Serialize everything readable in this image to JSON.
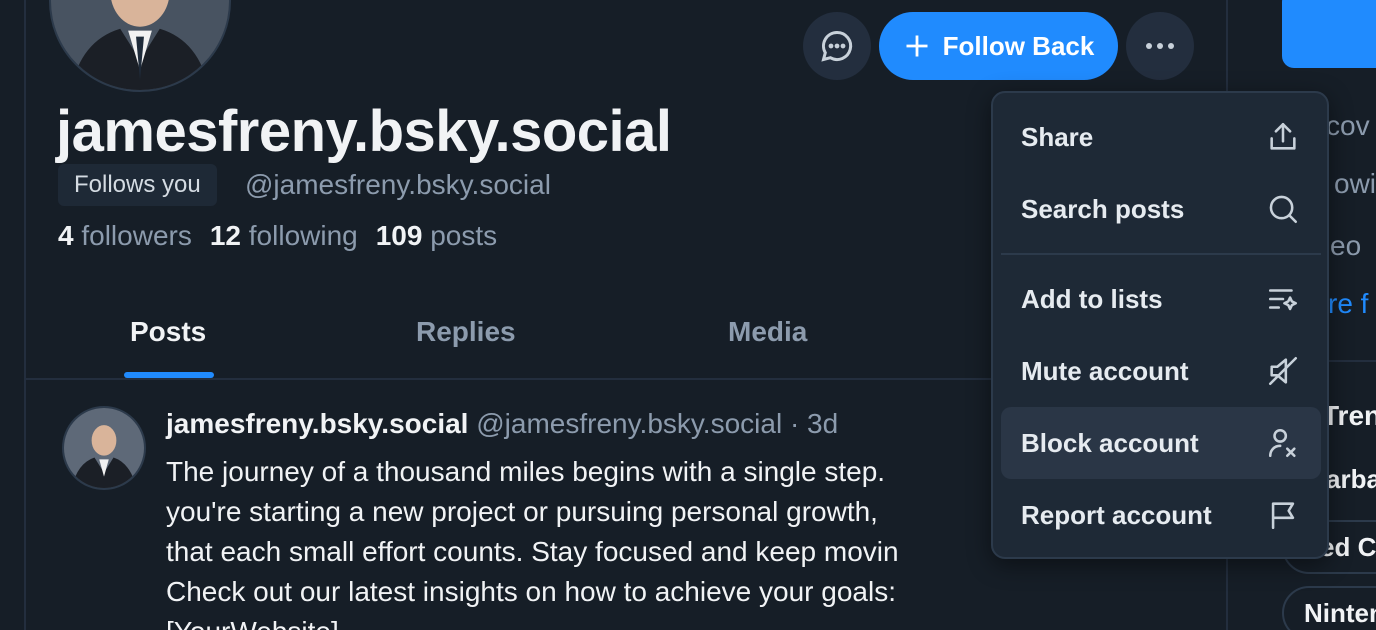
{
  "profile": {
    "display_name": "jamesfreny.bsky.social",
    "follows_you": "Follows you",
    "handle": "@jamesfreny.bsky.social",
    "stats": [
      {
        "count": "4",
        "label": "followers"
      },
      {
        "count": "12",
        "label": "following"
      },
      {
        "count": "109",
        "label": "posts"
      }
    ]
  },
  "actions": {
    "follow_back_label": "Follow Back"
  },
  "tabs": [
    "Posts",
    "Replies",
    "Media"
  ],
  "post": {
    "author": "jamesfreny.bsky.social",
    "meta": "@jamesfreny.bsky.social · 3d",
    "text_lines": [
      "The journey of a thousand miles begins with a single step.",
      "you're starting a new project or pursuing personal growth,",
      "that each small effort counts. Stay focused and keep movin",
      "Check out our latest insights on how to achieve your goals:",
      "[YourWebsite]"
    ]
  },
  "menu": {
    "items": [
      {
        "label": "Share",
        "icon": "share-icon"
      },
      {
        "label": "Search posts",
        "icon": "search-icon"
      },
      {
        "label": "Add to lists",
        "icon": "list-add-icon"
      },
      {
        "label": "Mute account",
        "icon": "mute-icon"
      },
      {
        "label": "Block account",
        "icon": "block-person-icon"
      },
      {
        "label": "Report account",
        "icon": "flag-icon"
      }
    ]
  },
  "right_panel": {
    "fragments": [
      "cov",
      "owi",
      "eo",
      "re f",
      "Tren"
    ],
    "chips": [
      "arba",
      "ed C",
      "Ninten"
    ]
  },
  "colors": {
    "background": "#161e27",
    "accent": "#208bfe",
    "menu_bg": "#1e2936",
    "muted_text": "#8c9bad"
  }
}
